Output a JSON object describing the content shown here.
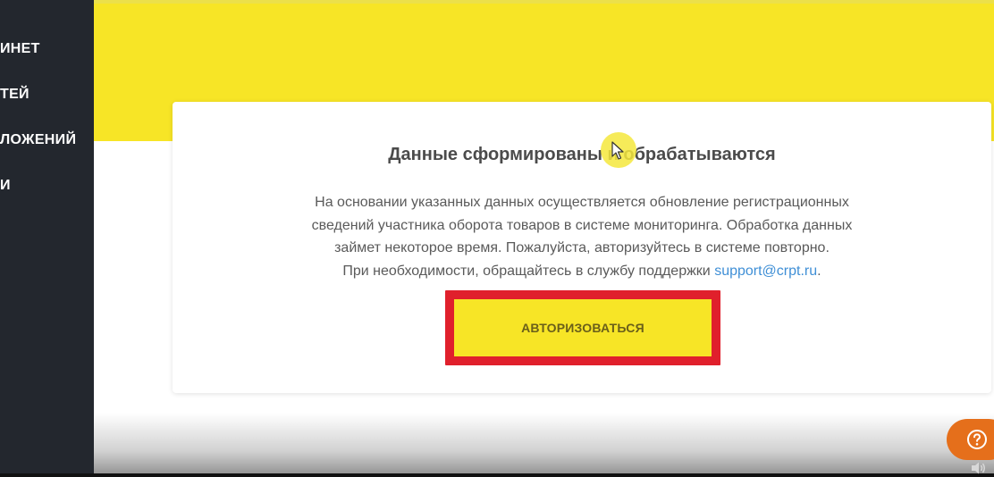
{
  "sidebar": {
    "items": [
      {
        "label": "ИНЕТ"
      },
      {
        "label": "ТЕЙ"
      },
      {
        "label": "ЛОЖЕНИЙ"
      },
      {
        "label": "И"
      }
    ]
  },
  "card": {
    "title": "Данные сформированы и обрабатываются",
    "text_lines": [
      "На основании указанных данных осуществляется обновление регистрационных",
      "сведений участника оборота товаров в системе мониторинга. Обработка данных",
      "займет некоторое время. Пожалуйста, авторизуйтесь в системе повторно."
    ],
    "support_prefix": "При необходимости, обращайтесь в службу поддержки ",
    "support_email": "support@crpt.ru",
    "support_suffix": ".",
    "auth_button_label": "АВТОРИЗОВАТЬСЯ"
  },
  "icons": {
    "help": "question-circle-icon",
    "volume": "volume-icon",
    "cursor": "mouse-cursor-icon"
  },
  "colors": {
    "brand_yellow": "#f7e526",
    "sidebar_bg": "#23272e",
    "highlight_red": "#e0202c",
    "link_blue": "#3f8fd6",
    "help_orange": "#e56f1b"
  }
}
